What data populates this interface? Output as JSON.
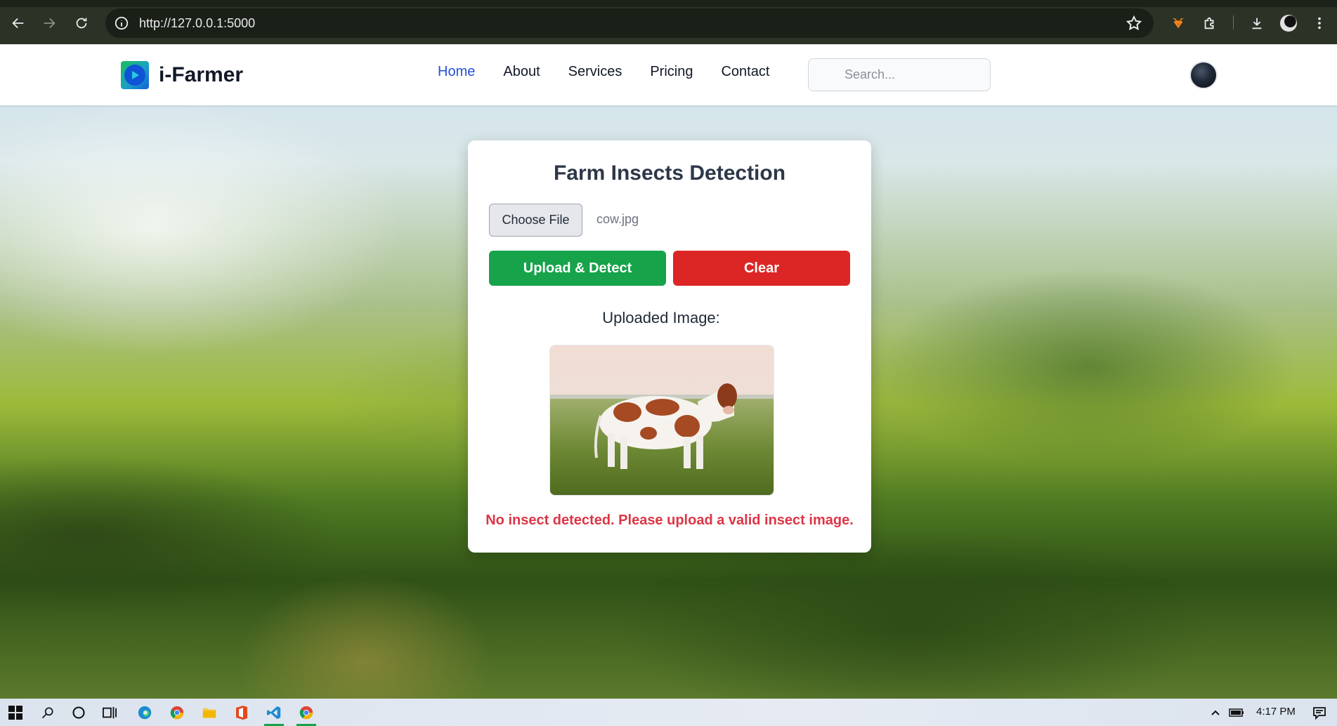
{
  "browser": {
    "url": "http://127.0.0.1:5000"
  },
  "navbar": {
    "brand": "i-Farmer",
    "links": [
      {
        "label": "Home",
        "active": true
      },
      {
        "label": "About",
        "active": false
      },
      {
        "label": "Services",
        "active": false
      },
      {
        "label": "Pricing",
        "active": false
      },
      {
        "label": "Contact",
        "active": false
      }
    ],
    "search_placeholder": "Search..."
  },
  "card": {
    "title": "Farm Insects Detection",
    "choose_file_label": "Choose File",
    "file_name": "cow.jpg",
    "upload_button": "Upload & Detect",
    "clear_button": "Clear",
    "uploaded_label": "Uploaded Image:",
    "result_message": "No insect detected. Please upload a valid insect image."
  },
  "taskbar": {
    "time": "4:17 PM"
  },
  "colors": {
    "accent": "#2450d6",
    "upload": "#16a34a",
    "clear": "#dc2626",
    "error": "#dc3545"
  }
}
